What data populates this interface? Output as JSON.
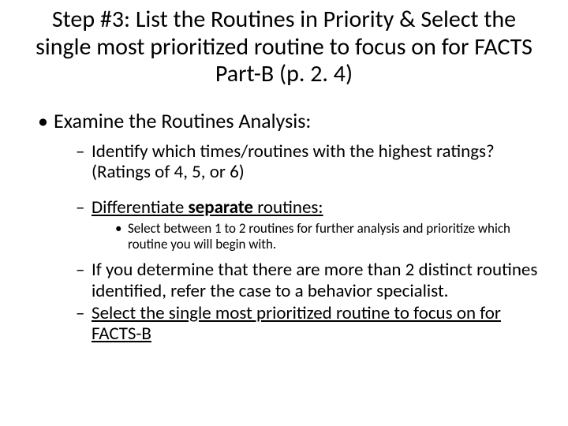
{
  "title": "Step #3: List the Routines in Priority & Select the single most prioritized routine to focus on for FACTS Part-B (p. 2. 4)",
  "b1": "Examine the Routines Analysis:",
  "b1_1": "Identify which times/routines with the highest ratings? (Ratings of 4, 5, or 6)",
  "b1_2_pre": "Differentiate ",
  "b1_2_sep": "separate",
  "b1_2_post": " routines:",
  "b1_2_1": "Select between 1 to 2 routines for further analysis and prioritize which routine you will begin with.",
  "b1_3": "If you determine that there are more than 2 distinct routines identified, refer the case to a behavior specialist.",
  "b1_4": "Select the single most prioritized routine to focus on for FACTS-B"
}
